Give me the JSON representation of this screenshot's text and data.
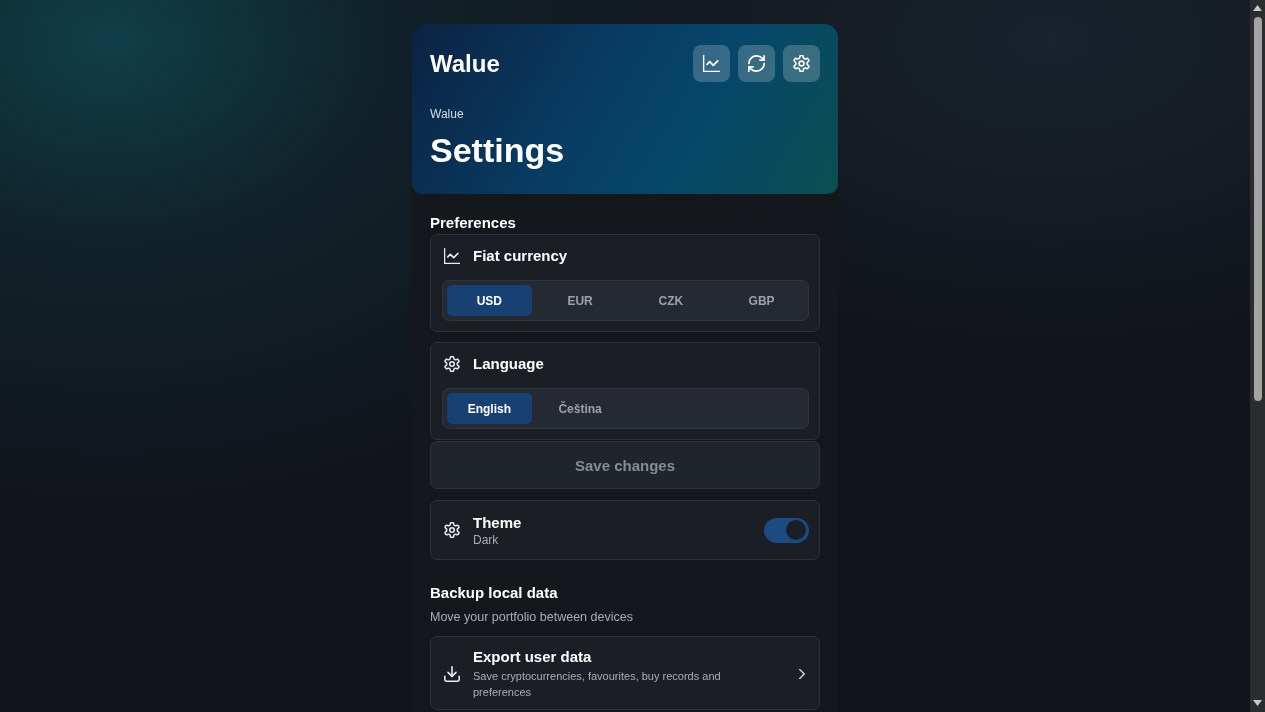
{
  "header": {
    "brand": "Walue",
    "breadcrumb": "Walue",
    "title": "Settings"
  },
  "preferences": {
    "heading": "Preferences",
    "settings": [
      {
        "label": "Fiat currency",
        "options": [
          {
            "label": "USD",
            "selected": true
          },
          {
            "label": "EUR",
            "selected": false
          },
          {
            "label": "CZK",
            "selected": false
          },
          {
            "label": "GBP",
            "selected": false
          }
        ]
      },
      {
        "label": "Language",
        "options": [
          {
            "label": "English",
            "selected": true
          },
          {
            "label": "Čeština",
            "selected": false
          }
        ]
      }
    ],
    "save_button": {
      "label": "Save changes",
      "disabled": true
    }
  },
  "theme": {
    "label": "Theme",
    "value": "Dark",
    "on": true
  },
  "backup": {
    "heading": "Backup local data",
    "description": "Move your portfolio between devices",
    "actions": [
      {
        "title": "Export user data",
        "description": "Save cryptocurrencies, favourites, buy records and preferences"
      }
    ]
  }
}
